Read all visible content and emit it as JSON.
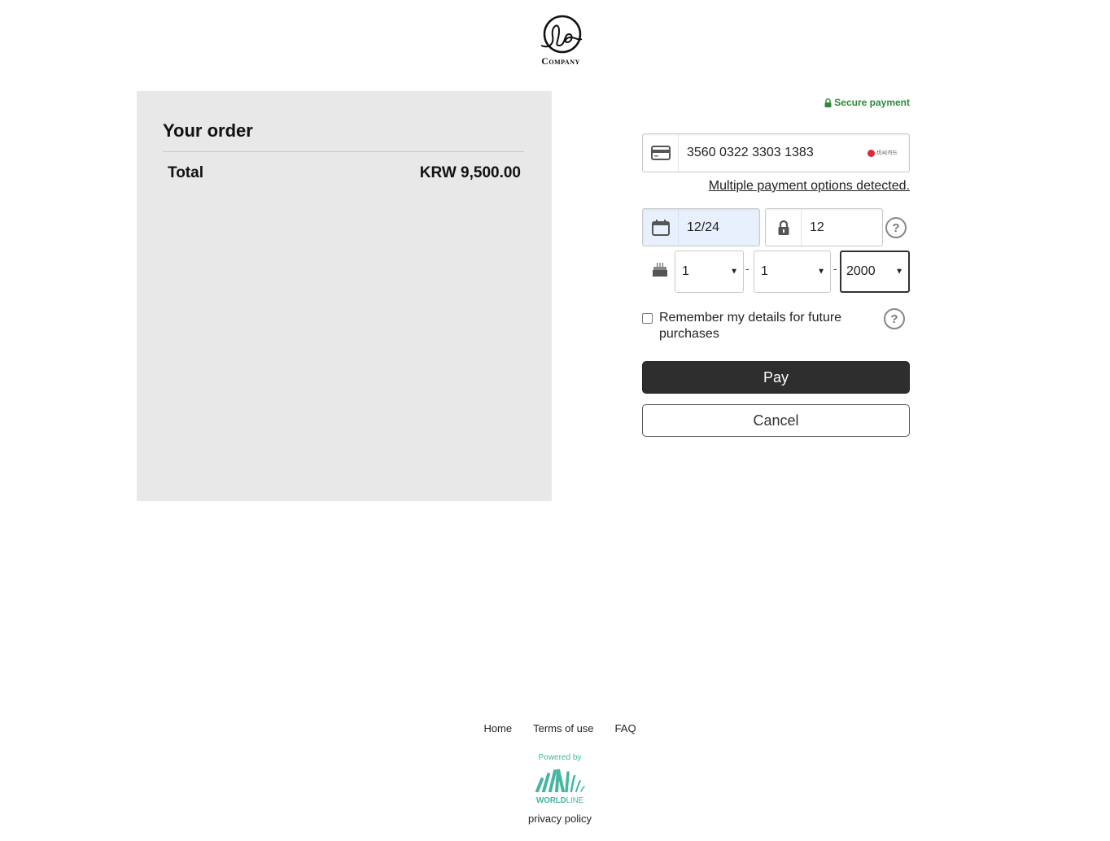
{
  "header": {
    "logo_text": "Company",
    "logo_icon": "company-swirl-logo"
  },
  "order": {
    "title": "Your order",
    "total_label": "Total",
    "total_value": "KRW 9,500.00"
  },
  "payment": {
    "secure_label": "Secure payment",
    "secure_icon": "lock-icon",
    "card_number": "3560 0322 3303 1383",
    "card_brand_label": "비씨카드",
    "multiple_options_link": "Multiple payment options detected.",
    "expiry": "12/24",
    "cvv": "12",
    "birthdate": {
      "day": "1",
      "month": "1",
      "year": "2000",
      "separator": "-"
    },
    "remember_label": "Remember my details for future purchases",
    "remember_checked": false,
    "help_glyph": "?",
    "pay_label": "Pay",
    "cancel_label": "Cancel"
  },
  "footer": {
    "links": [
      "Home",
      "Terms of use",
      "FAQ"
    ],
    "powered_by": "Powered by",
    "provider_name_bold": "WORLD",
    "provider_name_thin": "LINE",
    "privacy_label": "privacy policy"
  },
  "colors": {
    "secure_green": "#2c8a3a",
    "worldline_teal": "#46b5a1",
    "pay_button": "#2e2e2e",
    "order_panel": "#e8e8e8",
    "expiry_highlight": "#e8f0fe"
  }
}
